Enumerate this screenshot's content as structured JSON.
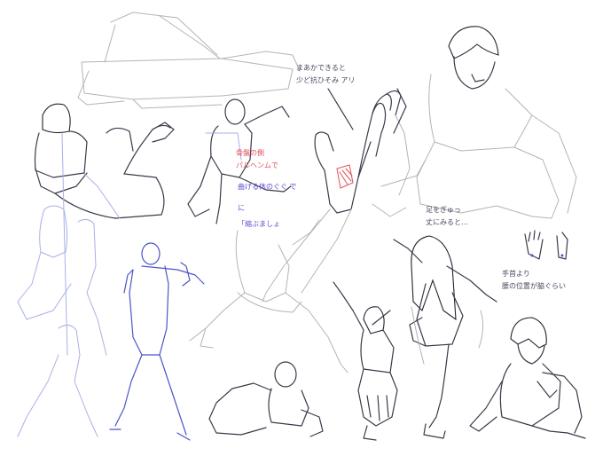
{
  "canvas": {
    "background": "#ffffff"
  },
  "colors": {
    "pencil_gray": "#b4b4b4",
    "ink_dark": "#3a3a4a",
    "ink_blue": "#4a55c8",
    "ink_light_blue": "#a9b0e6",
    "ink_red": "#e0505a",
    "ink_violet": "#5b4fd0"
  },
  "annotations": {
    "top_note_line1": "まあかできると",
    "top_note_line2": "少ど抗ひそみ アリ",
    "red_note_line1": "骨盤の側",
    "red_note_line2": "パルヘンムで",
    "violet_note_1": "曲げる体のぐぐ で",
    "violet_note_2": "に",
    "violet_note_3": "「縮ぶましょ",
    "right_note_line1": "足をぎゅっ",
    "right_note_line2": "丈にみると…",
    "hands_note_line1": "手首より",
    "hands_note_line2": "腰の位置が脇ぐらい"
  }
}
